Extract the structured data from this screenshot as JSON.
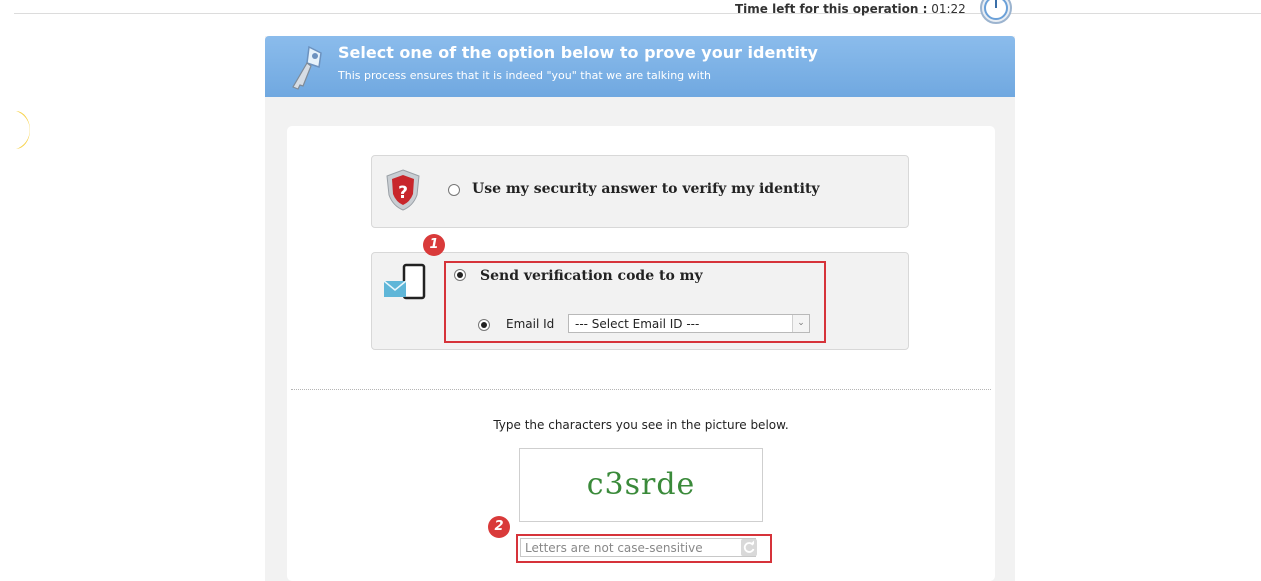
{
  "timer": {
    "label": "Time left for this operation :",
    "value": "01:22"
  },
  "header": {
    "title": "Select one of the option below to prove your identity",
    "subtitle": "This process ensures that it is indeed \"you\" that we are talking with"
  },
  "options": {
    "security": {
      "label": "Use my security answer to verify my identity",
      "selected": false
    },
    "send_code": {
      "label": "Send verification code to my",
      "selected": true,
      "email": {
        "label": "Email Id",
        "selected": true,
        "select_value": "--- Select Email ID ---"
      }
    }
  },
  "annotations": {
    "step1": "1",
    "step2": "2",
    "color": "#d6333a"
  },
  "captcha": {
    "instruction": "Type the characters you see in the picture below.",
    "image_text": "c3srde",
    "input_placeholder": "Letters are not case-sensitive"
  },
  "icons": [
    "clock-icon",
    "moon-icon",
    "key-icon",
    "shield-question-icon",
    "phone-email-icon",
    "refresh-icon"
  ],
  "colors": {
    "header_blue": "#70a8e0",
    "panel_bg": "#f2f2f2",
    "captcha_green": "#3a8a3a",
    "badge_red": "#d93a3a"
  }
}
